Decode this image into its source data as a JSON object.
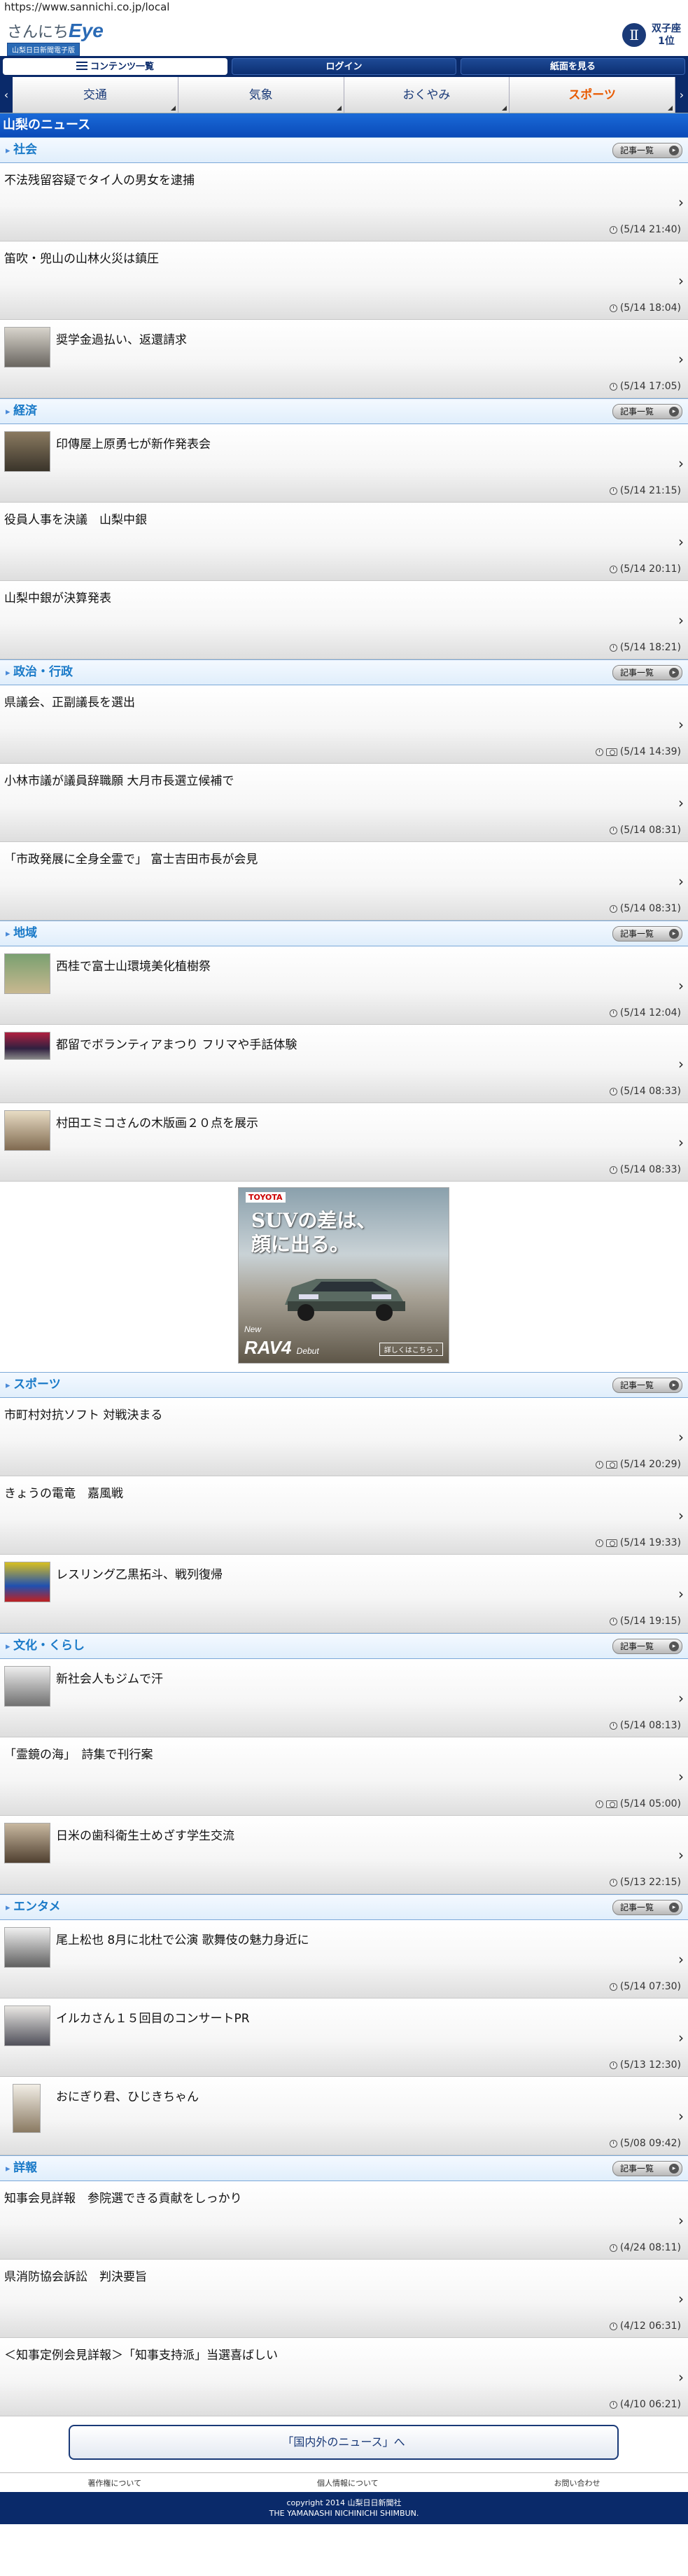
{
  "url": "https://www.sannichi.co.jp/local",
  "header": {
    "logo_prefix": "さんにち",
    "logo_main": "Eye",
    "logo_sub": "山梨日日新聞電子版",
    "horoscope_line1": "双子座",
    "horoscope_line2": "1位",
    "horoscope_glyph": "Ⅱ"
  },
  "nav": {
    "menu_label": "コンテンツ一覧",
    "login_label": "ログイン",
    "paper_label": "紙面を見る"
  },
  "category_tabs": {
    "prev_arrow": "‹",
    "next_arrow": "›",
    "items": [
      "交通",
      "気象",
      "おくやみ",
      "スポーツ"
    ],
    "active": "スポーツ"
  },
  "section_title": "山梨のニュース",
  "more_label": "記事一覧",
  "categories": [
    {
      "name": "社会",
      "articles": [
        {
          "title": "不法残留容疑でタイ人の男女を逮捕",
          "time": "(5/14 21:40)",
          "photo": false,
          "thumb": "none"
        },
        {
          "title": "笛吹・兜山の山林火災は鎮圧",
          "time": "(5/14 18:04)",
          "photo": false,
          "thumb": "none"
        },
        {
          "title": "奨学金過払い、返還請求",
          "time": "(5/14 17:05)",
          "photo": false,
          "thumb": "portrait"
        }
      ]
    },
    {
      "name": "経済",
      "articles": [
        {
          "title": "印傳屋上原勇七が新作発表会",
          "time": "(5/14 21:15)",
          "photo": false,
          "thumb": "group"
        },
        {
          "title": "役員人事を決議　山梨中銀",
          "time": "(5/14 20:11)",
          "photo": false,
          "thumb": "none"
        },
        {
          "title": "山梨中銀が決算発表",
          "time": "(5/14 18:21)",
          "photo": false,
          "thumb": "none"
        }
      ]
    },
    {
      "name": "政治・行政",
      "articles": [
        {
          "title": "県議会、正副議長を選出",
          "time": "(5/14 14:39)",
          "photo": true,
          "thumb": "none"
        },
        {
          "title": "小林市議が議員辞職願 大月市長選立候補で",
          "time": "(5/14 08:31)",
          "photo": false,
          "thumb": "none"
        },
        {
          "title": "「市政発展に全身全霊で」 富士吉田市長が会見",
          "time": "(5/14 08:31)",
          "photo": false,
          "thumb": "none"
        }
      ]
    },
    {
      "name": "地域",
      "articles": [
        {
          "title": "西桂で富士山環境美化植樹祭",
          "time": "(5/14 12:04)",
          "photo": false,
          "thumb": "outdoor"
        },
        {
          "title": "都留でボランティアまつり フリマや手話体験",
          "time": "(5/14 08:33)",
          "photo": false,
          "thumb": "stage"
        },
        {
          "title": "村田エミコさんの木版画２０点を展示",
          "time": "(5/14 08:33)",
          "photo": false,
          "thumb": "indoor"
        }
      ]
    },
    {
      "name": "スポーツ",
      "articles": [
        {
          "title": "市町村対抗ソフト 対戦決まる",
          "time": "(5/14 20:29)",
          "photo": true,
          "thumb": "none"
        },
        {
          "title": "きょうの電竜　嘉風戦",
          "time": "(5/14 19:33)",
          "photo": true,
          "thumb": "none"
        },
        {
          "title": "レスリング乙黒拓斗、戦列復帰",
          "time": "(5/14 19:15)",
          "photo": false,
          "thumb": "wrestling"
        }
      ]
    },
    {
      "name": "文化・くらし",
      "articles": [
        {
          "title": "新社会人もジムで汗",
          "time": "(5/14 08:13)",
          "photo": false,
          "thumb": "gym"
        },
        {
          "title": "「霊鏡の海」　詩集で刊行案",
          "time": "(5/14 05:00)",
          "photo": true,
          "thumb": "none"
        },
        {
          "title": "日米の歯科衛生士めざす学生交流",
          "time": "(5/13 22:15)",
          "photo": false,
          "thumb": "class"
        }
      ]
    },
    {
      "name": "エンタメ",
      "articles": [
        {
          "title": "尾上松也 8月に北杜で公演 歌舞伎の魅力身近に",
          "time": "(5/14 07:30)",
          "photo": false,
          "thumb": "actor"
        },
        {
          "title": "イルカさん１５回目のコンサートPR",
          "time": "(5/13 12:30)",
          "photo": false,
          "thumb": "press"
        },
        {
          "title": "おにぎり君、ひじきちゃん",
          "time": "(5/08 09:42)",
          "photo": false,
          "thumb": "doll"
        }
      ]
    },
    {
      "name": "詳報",
      "articles": [
        {
          "title": "知事会見詳報　参院選できる貢献をしっかり",
          "time": "(4/24 08:11)",
          "photo": false,
          "thumb": "none"
        },
        {
          "title": "県消防協会訴訟　判決要旨",
          "time": "(4/12 06:31)",
          "photo": false,
          "thumb": "none"
        },
        {
          "title": "＜知事定例会見詳報＞「知事支持派」当選喜ばしい",
          "time": "(4/10 06:21)",
          "photo": false,
          "thumb": "none"
        }
      ]
    }
  ],
  "ad": {
    "brand": "TOYOTA",
    "copy_line1": "SUVの差は、",
    "copy_line2": "顔に出る。",
    "model_prefix": "New",
    "model": "RAV4",
    "model_suffix": "Debut",
    "more": "詳しくはこちら ›"
  },
  "bottom_link": "「国内外のニュース」へ",
  "footer": {
    "links": [
      "著作権について",
      "個人情報について",
      "お問い合わせ"
    ],
    "copyright_line1": "copyright 2014 山梨日日新聞社",
    "copyright_line2": "THE YAMANASHI NICHINICHI SHIMBUN."
  },
  "colors": {
    "navy": "#0a2a6a",
    "section_blue": "#1a6ad8",
    "category_text": "#1a7ac8",
    "active_tab": "#e85a00"
  },
  "icons": {
    "clock": "clock-icon",
    "camera": "camera-icon",
    "chevron": "chevron-right-icon",
    "menu": "menu-icon"
  }
}
